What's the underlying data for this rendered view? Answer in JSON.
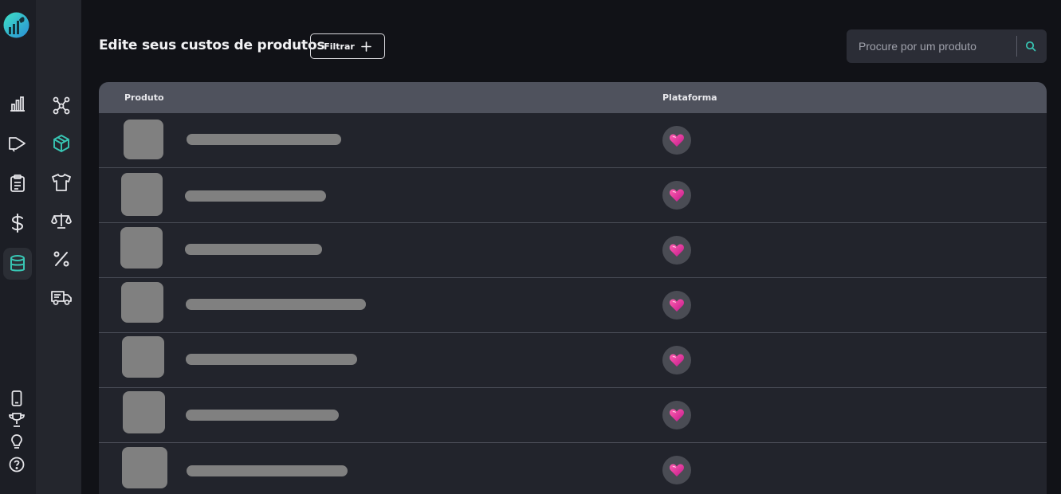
{
  "app": {
    "brand_color": "#38c6b4",
    "platform_color": "#e83f8f"
  },
  "rail": {
    "logo": "company-logo",
    "items": [
      {
        "icon": "bar-chart-icon",
        "active": false
      },
      {
        "icon": "megaphone-icon",
        "active": false
      },
      {
        "icon": "clipboard-icon",
        "active": false
      },
      {
        "icon": "dollar-icon",
        "active": false
      },
      {
        "icon": "database-icon",
        "active": true
      }
    ],
    "bottom_items": [
      {
        "icon": "smartphone-icon"
      },
      {
        "icon": "trophy-icon"
      },
      {
        "icon": "lightbulb-icon"
      },
      {
        "icon": "help-icon"
      }
    ]
  },
  "subnav": {
    "items": [
      {
        "icon": "network-icon",
        "active": false
      },
      {
        "icon": "box-icon",
        "active": true
      },
      {
        "icon": "shirt-icon",
        "active": false
      },
      {
        "icon": "scale-icon",
        "active": false
      },
      {
        "icon": "percent-icon",
        "active": false
      },
      {
        "icon": "truck-icon",
        "active": false
      }
    ]
  },
  "header": {
    "title": "Edite seus custos de produtos",
    "filter_label": "Filtrar"
  },
  "search": {
    "placeholder": "Procure por um produto"
  },
  "table": {
    "columns": [
      "Produto",
      "Plataforma"
    ],
    "rows": [
      {
        "product": "",
        "platform": "heart-platform-icon"
      },
      {
        "product": "",
        "platform": "heart-platform-icon"
      },
      {
        "product": "",
        "platform": "heart-platform-icon"
      },
      {
        "product": "",
        "platform": "heart-platform-icon"
      },
      {
        "product": "",
        "platform": "heart-platform-icon"
      },
      {
        "product": "",
        "platform": "heart-platform-icon"
      },
      {
        "product": "",
        "platform": "heart-platform-icon"
      }
    ]
  }
}
